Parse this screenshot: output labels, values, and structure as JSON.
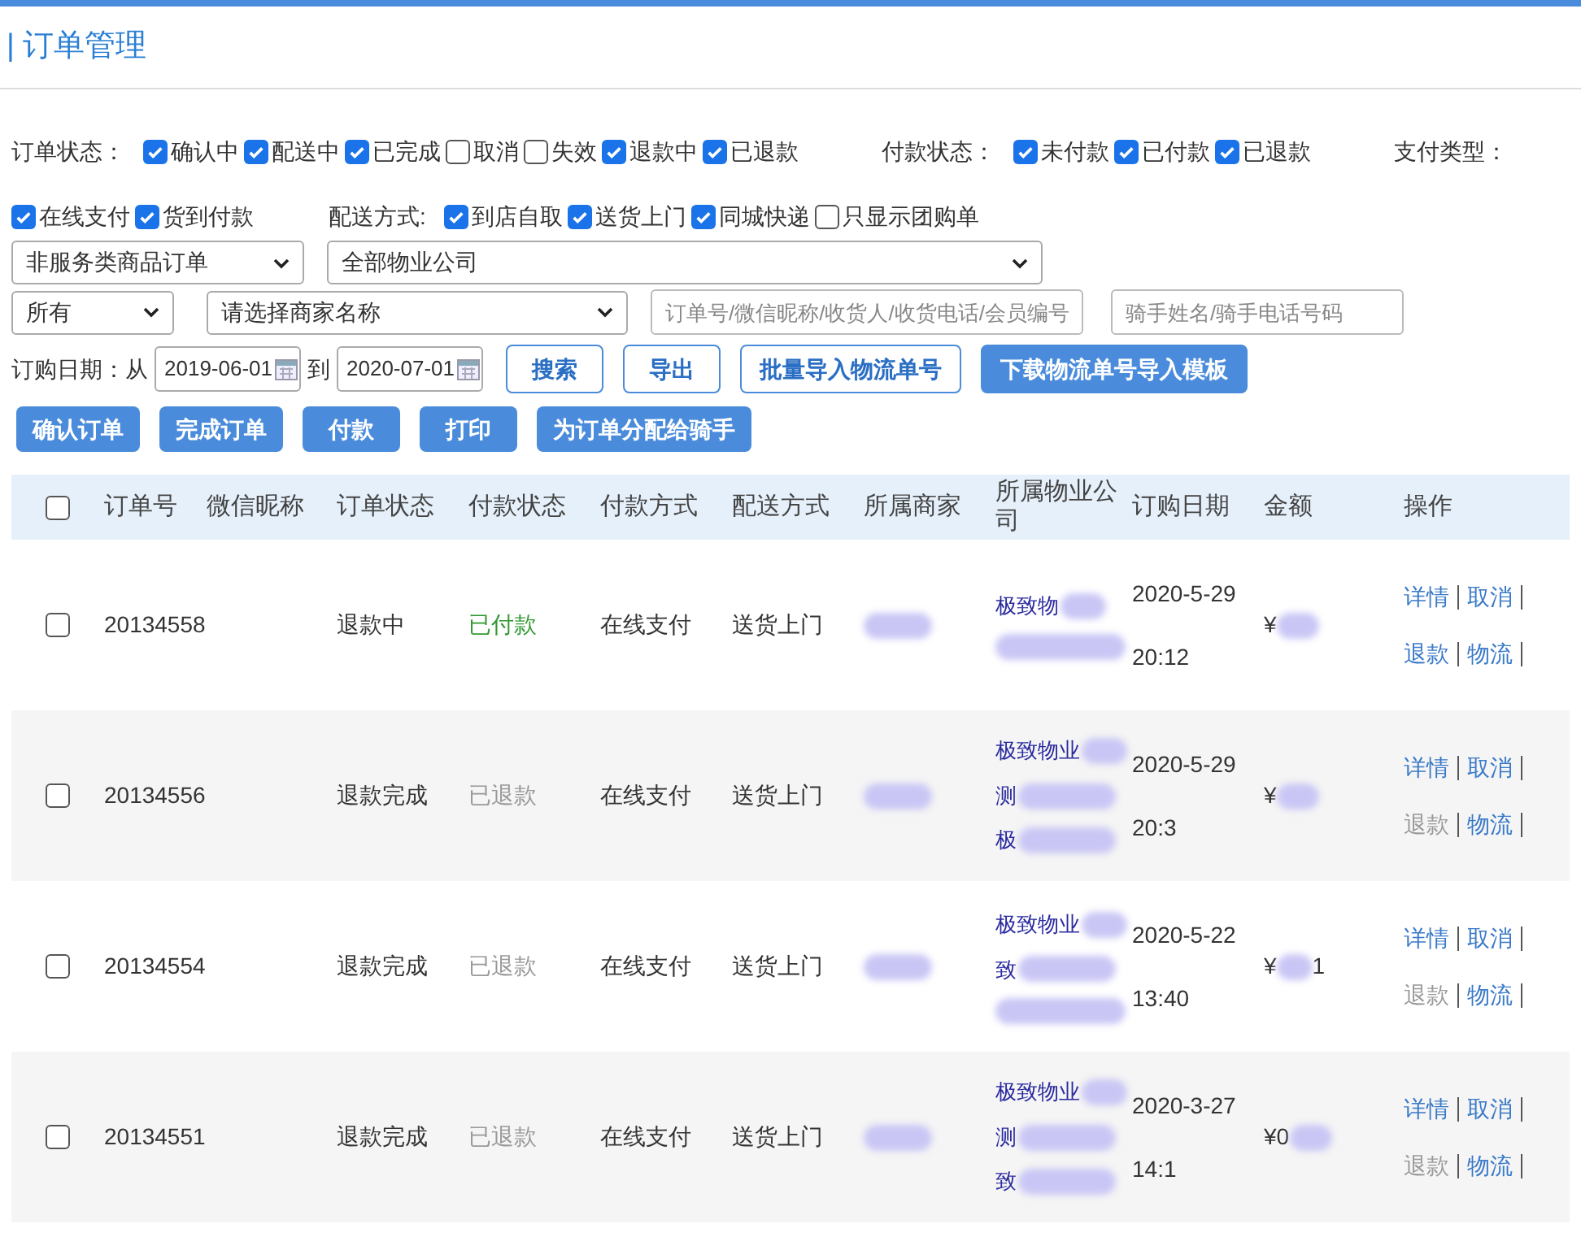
{
  "page_title": "| 订单管理",
  "filter_groups": [
    {
      "label": "订单状态：",
      "options": [
        {
          "label": "确认中",
          "checked": true
        },
        {
          "label": "配送中",
          "checked": true
        },
        {
          "label": "已完成",
          "checked": true
        },
        {
          "label": "取消",
          "checked": false
        },
        {
          "label": "失效",
          "checked": false
        },
        {
          "label": "退款中",
          "checked": true
        },
        {
          "label": "已退款",
          "checked": true
        }
      ]
    },
    {
      "label": "付款状态：",
      "options": [
        {
          "label": "未付款",
          "checked": true
        },
        {
          "label": "已付款",
          "checked": true
        },
        {
          "label": "已退款",
          "checked": true
        }
      ]
    },
    {
      "label": "支付类型：",
      "options": [
        {
          "label": "在线支付",
          "checked": true
        },
        {
          "label": "货到付款",
          "checked": true
        }
      ]
    },
    {
      "label": "配送方式:",
      "options": [
        {
          "label": "到店自取",
          "checked": true
        },
        {
          "label": "送货上门",
          "checked": true
        },
        {
          "label": "同城快递",
          "checked": true
        },
        {
          "label": "只显示团购单",
          "checked": false
        }
      ]
    }
  ],
  "selects": {
    "order_type": "非服务类商品订单",
    "property_company": "全部物业公司",
    "scope": "所有",
    "merchant": "请选择商家名称"
  },
  "search_placeholder": "订单号/微信昵称/收货人/收货电话/会员编号",
  "rider_placeholder": "骑手姓名/骑手电话号码",
  "date_label": "订购日期：从",
  "date_from": "2019-06-01",
  "date_to_label": "到",
  "date_to": "2020-07-01",
  "toolbar_buttons": [
    {
      "label": "搜索",
      "kind": "outline"
    },
    {
      "label": "导出",
      "kind": "outline"
    },
    {
      "label": "批量导入物流单号",
      "kind": "outline"
    },
    {
      "label": "下载物流单号导入模板",
      "kind": "solid"
    }
  ],
  "action_buttons": [
    "确认订单",
    "完成订单",
    "付款",
    "打印",
    "为订单分配给骑手"
  ],
  "table": {
    "header_checked": false,
    "columns": [
      "订单号",
      "微信昵称",
      "订单状态",
      "付款状态",
      "付款方式",
      "配送方式",
      "所属商家",
      "所属物业公司",
      "订购日期",
      "金额",
      "操作"
    ],
    "rows": [
      {
        "checked": false,
        "order_no": "20134558",
        "status": "退款中",
        "pay_status": "已付款",
        "pay_disabled": false,
        "pay_method": "在线支付",
        "delivery": "送货上门",
        "merchant": [],
        "company": [
          "极致物"
        ],
        "date": [
          "2020-5-29",
          "20:12"
        ],
        "amount": [
          "¥"
        ],
        "actions": [
          {
            "label": "详情",
            "disabled": false
          },
          {
            "label": "取消",
            "disabled": false
          },
          {
            "label": "退款",
            "disabled": false
          },
          {
            "label": "物流",
            "disabled": false
          }
        ]
      },
      {
        "checked": false,
        "order_no": "20134556",
        "status": "退款完成",
        "pay_status": "已退款",
        "pay_disabled": true,
        "pay_method": "在线支付",
        "delivery": "送货上门",
        "merchant": [],
        "company": [
          "极致物业",
          "测",
          "极"
        ],
        "date": [
          "2020-5-29",
          "20:3"
        ],
        "amount": [
          "¥"
        ],
        "actions": [
          {
            "label": "详情",
            "disabled": false
          },
          {
            "label": "取消",
            "disabled": false
          },
          {
            "label": "退款",
            "disabled": true
          },
          {
            "label": "物流",
            "disabled": false
          }
        ]
      },
      {
        "checked": false,
        "order_no": "20134554",
        "status": "退款完成",
        "pay_status": "已退款",
        "pay_disabled": true,
        "pay_method": "在线支付",
        "delivery": "送货上门",
        "merchant": [],
        "company": [
          "极致物业",
          "致"
        ],
        "date": [
          "2020-5-22",
          "13:40"
        ],
        "amount": [
          "¥",
          "1"
        ],
        "actions": [
          {
            "label": "详情",
            "disabled": false
          },
          {
            "label": "取消",
            "disabled": false
          },
          {
            "label": "退款",
            "disabled": true
          },
          {
            "label": "物流",
            "disabled": false
          }
        ]
      },
      {
        "checked": false,
        "order_no": "20134551",
        "status": "退款完成",
        "pay_status": "已退款",
        "pay_disabled": true,
        "pay_method": "在线支付",
        "delivery": "送货上门",
        "merchant": [],
        "company": [
          "极致物业",
          "测",
          "致"
        ],
        "date": [
          "2020-3-27",
          "14:1"
        ],
        "amount": [
          "¥0"
        ],
        "actions": [
          {
            "label": "详情",
            "disabled": false
          },
          {
            "label": "取消",
            "disabled": false
          },
          {
            "label": "退款",
            "disabled": true
          },
          {
            "label": "物流",
            "disabled": false
          }
        ]
      }
    ]
  }
}
